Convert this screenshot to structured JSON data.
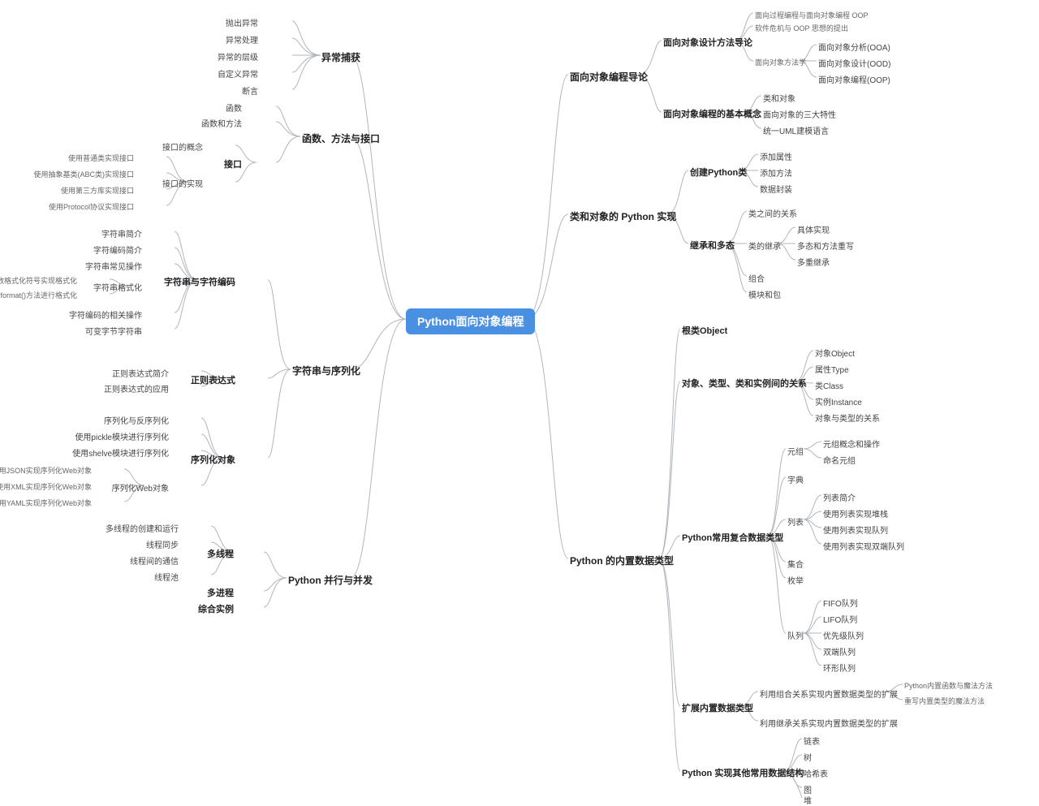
{
  "root": "Python面向对象编程",
  "left": {
    "exception": {
      "title": "异常捕获",
      "items": [
        "抛出异常",
        "异常处理",
        "异常的层级",
        "自定义异常",
        "断言"
      ]
    },
    "func": {
      "title": "函数、方法与接口",
      "items": [
        "函数",
        "函数和方法"
      ],
      "interface": {
        "label": "接口",
        "concept": "接口的概念",
        "impl_label": "接口的实现",
        "impls": [
          "使用普通类实现接口",
          "使用抽象基类(ABC类)实现接口",
          "使用第三方库实现接口",
          "使用Protocol协议实现接口"
        ]
      }
    },
    "string_serial": {
      "title": "字符串与序列化",
      "string_enc": {
        "label": "字符串与字符编码",
        "items": [
          "字符串简介",
          "字符编码简介",
          "字符串常见操作",
          "字符编码的相关操作",
          "可变字节字符串"
        ],
        "format_label": "字符串格式化",
        "formats": [
          "使用Print函数格式化符号实现格式化",
          "使用format()方法进行格式化"
        ]
      },
      "regex": {
        "label": "正则表达式",
        "items": [
          "正则表达式简介",
          "正则表达式的应用"
        ]
      },
      "serialize": {
        "label": "序列化对象",
        "items": [
          "序列化与反序列化",
          "使用pickle模块进行序列化",
          "使用shelve模块进行序列化"
        ],
        "web_label": "序列化Web对象",
        "web": [
          "使用JSON实现序列化Web对象",
          "使用XML实现序列化Web对象",
          "使用YAML实现序列化Web对象"
        ]
      }
    },
    "concurrent": {
      "title": "Python 并行与并发",
      "mt_label": "多线程",
      "mt": [
        "多线程的创建和运行",
        "线程同步",
        "线程间的通信",
        "线程池"
      ],
      "mp": "多进程",
      "ex": "综合实例"
    }
  },
  "right": {
    "oop_intro": {
      "title": "面向对象编程导论",
      "design_intro": {
        "label": "面向对象设计方法导论",
        "items": [
          "面向过程编程与面向对象编程 OOP",
          "软件危机与 OOP 思想的提出"
        ],
        "methodology_label": "面向对象方法学",
        "methodology": [
          "面向对象分析(OOA)",
          "面向对象设计(OOD)",
          "面向对象编程(OOP)"
        ]
      },
      "basic": {
        "label": "面向对象编程的基本概念",
        "items": [
          "类和对象",
          "面向对象的三大特性",
          "统一UML建模语言"
        ]
      }
    },
    "class_impl": {
      "title": "类和对象的 Python 实现",
      "create": {
        "label": "创建Python类",
        "items": [
          "添加属性",
          "添加方法",
          "数据封装"
        ]
      },
      "inherit": {
        "label": "继承和多态",
        "relation": "类之间的关系",
        "inherit_label": "类的继承",
        "inherit_items": [
          "具体实现",
          "多态和方法重写",
          "多重继承"
        ],
        "tail": [
          "组合",
          "模块和包"
        ]
      }
    },
    "builtin": {
      "title": "Python 的内置数据类型",
      "root_class": "根类Object",
      "obj_rel": {
        "label": "对象、类型、类和实例间的关系",
        "items": [
          "对象Object",
          "属性Type",
          "类Class",
          "实例Instance",
          "对象与类型的关系"
        ]
      },
      "common": {
        "label": "Python常用复合数据类型",
        "tuple_label": "元组",
        "tuple_items": [
          "元组概念和操作",
          "命名元组"
        ],
        "dict": "字典",
        "list_label": "列表",
        "list_items": [
          "列表简介",
          "使用列表实现堆栈",
          "使用列表实现队列",
          "使用列表实现双端队列"
        ],
        "set": "集合",
        "enum": "枚举",
        "queue_label": "队列",
        "queue_items": [
          "FIFO队列",
          "LIFO队列",
          "优先级队列",
          "双端队列",
          "环形队列"
        ]
      },
      "extend": {
        "label": "扩展内置数据类型",
        "comp_label": "利用组合关系实现内置数据类型的扩展",
        "comp_items": [
          "Python内置函数与魔法方法",
          "重写内置类型的魔法方法"
        ],
        "inherit": "利用继承关系实现内置数据类型的扩展"
      },
      "other": {
        "label": "Python 实现其他常用数据结构",
        "items": [
          "链表",
          "树",
          "哈希表",
          "图",
          "堆"
        ]
      }
    }
  }
}
